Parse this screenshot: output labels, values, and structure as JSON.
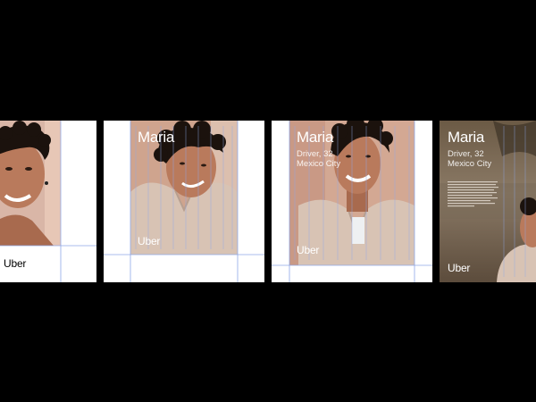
{
  "panels": [
    {
      "logo": "Uber"
    },
    {
      "name": "Maria",
      "logo": "Uber"
    },
    {
      "name": "Maria",
      "meta_line1": "Driver, 32",
      "meta_line2": "Mexico City",
      "logo": "Uber"
    },
    {
      "name": "Maria",
      "meta_line1": "Driver, 32",
      "meta_line2": "Mexico City",
      "logo": "Uber"
    }
  ],
  "colors": {
    "background": "#000000",
    "panel": "#ffffff",
    "guides": "#8fa8e8",
    "skin": "#b97a5c",
    "hair": "#1b120d",
    "shirt": "#d8c3b4"
  },
  "icons": [
    "portrait-photo"
  ]
}
